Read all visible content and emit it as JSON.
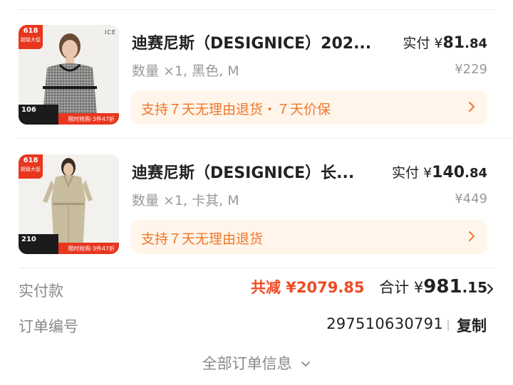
{
  "colors": {
    "accent_orange": "#f0772a",
    "service_bg": "#fff5ea",
    "reduce_red": "#ef4b25",
    "muted": "#999999"
  },
  "products": [
    {
      "title": "迪赛尼斯（DESIGNICE）202...",
      "specs": "数量 ×1, 黑色, M",
      "paid_label": "实付",
      "currency": "¥",
      "paid_int": "81",
      "paid_dec": ".84",
      "original_price": "¥229",
      "service": "支持７天无理由退货・７天价保",
      "thumb_badge": "618",
      "thumb_badge_sub": "超级大促",
      "thumb_brand": "ICE",
      "thumb_price": "106",
      "thumb_promo": "限时抢购·3件47折",
      "thumb_icon": "product-photo-woman-tweed-top"
    },
    {
      "title": "迪赛尼斯（DESIGNICE）长...",
      "specs": "数量 ×1, 卡其, M",
      "paid_label": "实付",
      "currency": "¥",
      "paid_int": "140",
      "paid_dec": ".84",
      "original_price": "¥449",
      "service": "支持７天无理由退货",
      "thumb_badge": "618",
      "thumb_badge_sub": "超级大促",
      "thumb_brand": "",
      "thumb_price": "210",
      "thumb_promo": "限时抢购·3件47折",
      "thumb_icon": "product-photo-woman-khaki-dress"
    }
  ],
  "summary": {
    "label": "实付款",
    "reduce_text": "共减 ¥2079.85",
    "total_label": "合计",
    "currency": "¥",
    "total_int": "981",
    "total_dec": ".15"
  },
  "order": {
    "label": "订单编号",
    "number": "297510630791",
    "copy_label": "复制"
  },
  "footer": {
    "all_info_label": "全部订单信息"
  }
}
